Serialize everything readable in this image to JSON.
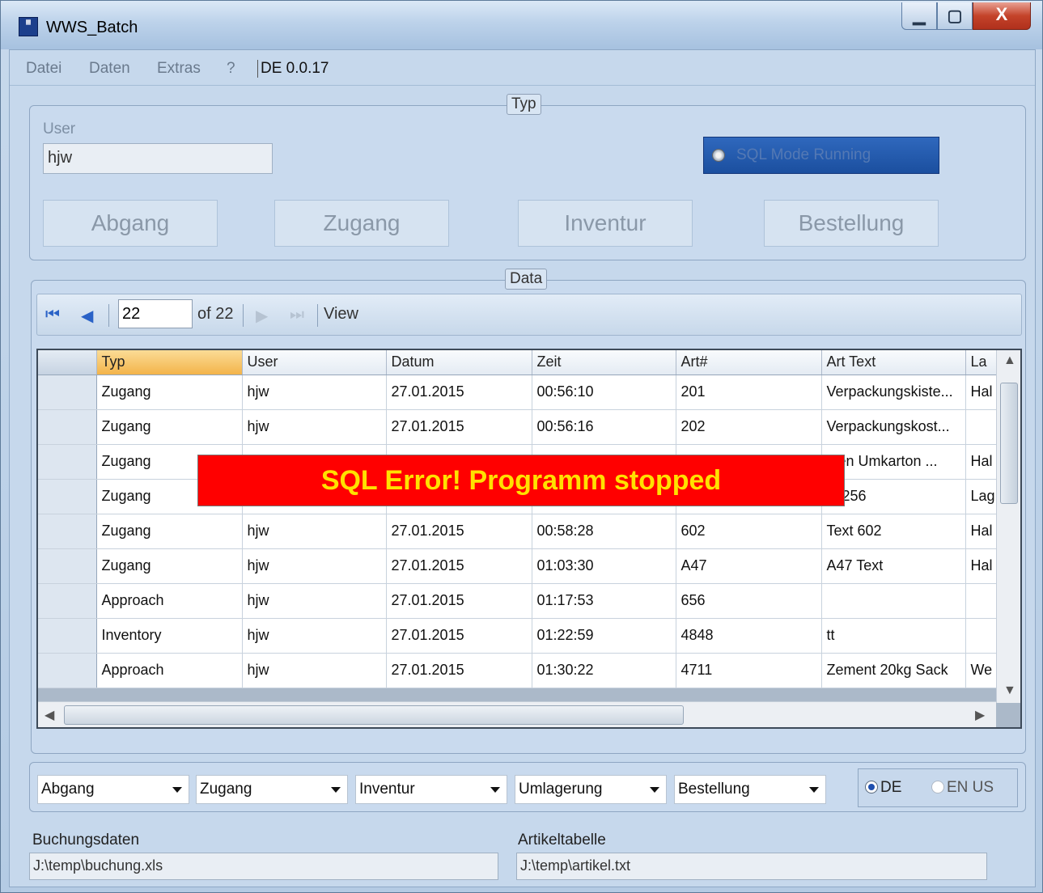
{
  "window": {
    "title": "WWS_Batch",
    "min_glyph": "▁",
    "max_glyph": "▢",
    "close_glyph": "X"
  },
  "menu": {
    "items": [
      "Datei",
      "Daten",
      "Extras",
      "?"
    ],
    "version": "DE 0.0.17"
  },
  "typ_group": {
    "legend": "Typ",
    "user_label": "User",
    "user_value": "hjw",
    "sql_mode_label": "SQL Mode Running",
    "buttons": [
      "Abgang",
      "Zugang",
      "Inventur",
      "Bestellung"
    ]
  },
  "data_group": {
    "legend": "Data",
    "navigator": {
      "position": "22",
      "of_text": "of 22",
      "view_label": "View"
    },
    "grid": {
      "columns": [
        "Typ",
        "User",
        "Datum",
        "Zeit",
        "Art#",
        "Art Text",
        "La"
      ],
      "rows": [
        [
          "Zugang",
          "hjw",
          "27.01.2015",
          "00:56:10",
          "201",
          "Verpackungskiste...",
          "Hal"
        ],
        [
          "Zugang",
          "hjw",
          "27.01.2015",
          "00:56:16",
          "202",
          "Verpackungskost...",
          ""
        ],
        [
          "Zugang",
          "",
          "",
          "",
          "",
          "sten Umkarton ...",
          "Hal"
        ],
        [
          "Zugang",
          "",
          "",
          "",
          "",
          "xt 256",
          "Lag"
        ],
        [
          "Zugang",
          "hjw",
          "27.01.2015",
          "00:58:28",
          "602",
          "Text 602",
          "Hal"
        ],
        [
          "Zugang",
          "hjw",
          "27.01.2015",
          "01:03:30",
          "A47",
          "A47 Text",
          "Hal"
        ],
        [
          "Approach",
          "hjw",
          "27.01.2015",
          "01:17:53",
          "656",
          "",
          ""
        ],
        [
          "Inventory",
          "hjw",
          "27.01.2015",
          "01:22:59",
          "4848",
          "tt",
          ""
        ],
        [
          "Approach",
          "hjw",
          "27.01.2015",
          "01:30:22",
          "4711",
          "Zement 20kg Sack",
          "We"
        ]
      ]
    },
    "error_message": "SQL Error! Programm stopped"
  },
  "bottom": {
    "combos": [
      "Abgang",
      "Zugang",
      "Inventur",
      "Umlagerung",
      "Bestellung"
    ],
    "lang_de": "DE",
    "lang_en": "EN US",
    "buchungsdaten_label": "Buchungsdaten",
    "buchungsdaten_value": "J:\\temp\\buchung.xls",
    "artikeltabelle_label": "Artikeltabelle",
    "artikeltabelle_value": "J:\\temp\\artikel.txt"
  },
  "colors": {
    "error_bg": "#ff0000",
    "error_text": "#ffe100",
    "sql_mode_bg": "#1b4f9f",
    "header_selected": "#f3b44a"
  }
}
